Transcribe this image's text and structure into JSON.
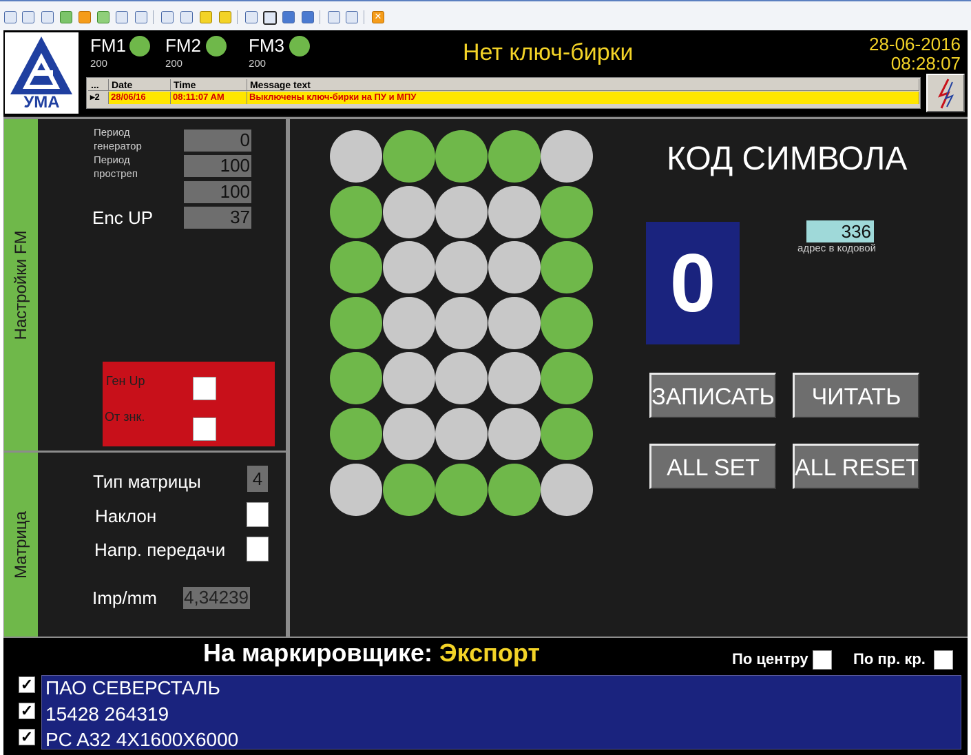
{
  "toolbar": {
    "icons": [
      "window-icon",
      "monitor-icon",
      "terminal-icon",
      "refresh-icon",
      "stop-icon",
      "users-icon",
      "phone-icon",
      "chat-icon",
      "user-icon",
      "group-icon",
      "save-icon",
      "lock-icon",
      "frame-icon",
      "screen-icon",
      "screen2-icon",
      "gear-icon",
      "copy-icon",
      "tools-icon",
      "close-icon"
    ]
  },
  "header": {
    "logo_text": "УМА",
    "fm": [
      {
        "label": "FM1",
        "value": "200",
        "status": "ok"
      },
      {
        "label": "FM2",
        "value": "200",
        "status": "ok"
      },
      {
        "label": "FM3",
        "value": "200",
        "status": "ok"
      }
    ],
    "title": "Нет ключ-бирки",
    "date": "28-06-2016",
    "time": "08:28:07",
    "colors": {
      "accent": "#f3d327",
      "led": "#6fb84a",
      "bg": "#000000"
    }
  },
  "messages": {
    "columns": [
      "...",
      "Date",
      "Time",
      "Message text"
    ],
    "rows": [
      {
        "n": "2",
        "date": "28/06/16",
        "time": "08:11:07 AM",
        "text": "Выключены ключ-бирки на ПУ и МПУ"
      }
    ]
  },
  "settings": {
    "tab_label": "Настройки FM",
    "period_gen_label": "Период генератор",
    "period_gen_value": "0",
    "period_prostr_label": "Период простреп",
    "period_prostr_value": "100",
    "value3": "100",
    "enc_up_label": "Enc UP",
    "enc_up_value": "37",
    "red_panel": {
      "gen_up_label": "Ген Up",
      "ot_znk_label": "От знк.",
      "gen_up_checked": false,
      "ot_znk_checked": false,
      "color": "#c8101a"
    }
  },
  "matrix": {
    "tab_label": "Матрица",
    "type_label": "Тип матрицы",
    "type_value": "4",
    "naklon_label": "Наклон",
    "naklon_checked": false,
    "napr_label": "Напр. передачи",
    "napr_checked": false,
    "imp_label": "Imp/mm",
    "imp_value": "4,34239"
  },
  "grid": {
    "rows": [
      [
        0,
        1,
        1,
        1,
        0
      ],
      [
        1,
        0,
        0,
        0,
        1
      ],
      [
        1,
        0,
        0,
        0,
        1
      ],
      [
        1,
        0,
        0,
        0,
        1
      ],
      [
        1,
        0,
        0,
        0,
        1
      ],
      [
        1,
        0,
        0,
        0,
        1
      ],
      [
        0,
        1,
        1,
        1,
        0
      ]
    ],
    "on_color": "#6fb84a",
    "off_color": "#c8c8c8"
  },
  "symbol": {
    "title": "КОД СИМВОЛА",
    "code": "0",
    "address_value": "336",
    "address_label": "адрес в кодовой",
    "buttons": {
      "write": "ЗАПИСАТЬ",
      "read": "ЧИТАТЬ",
      "all_set": "ALL SET",
      "all_reset": "ALL RESET"
    }
  },
  "bottom": {
    "marker_label": "На маркировщике:",
    "marker_value": "Экспорт",
    "center_label": "По центру",
    "center_checked": false,
    "edge_label": "По пр. кр.",
    "edge_checked": false,
    "lines": [
      {
        "text": "ПАО СЕВЕРСТАЛЬ",
        "checked": true
      },
      {
        "text": "15428  264319",
        "checked": true
      },
      {
        "text": "PC A32 4X1600X6000",
        "checked": true
      }
    ]
  }
}
